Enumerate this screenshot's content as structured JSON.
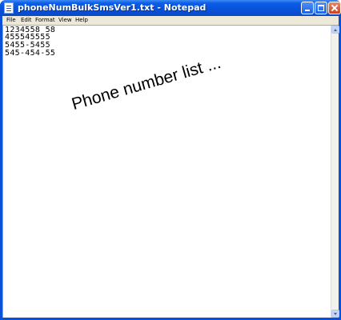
{
  "window": {
    "title": "phoneNumBulkSmsVer1.txt - Notepad",
    "title_bar_color": "#0a50d8",
    "close_button_color": "#c9421e"
  },
  "menu": {
    "items": [
      {
        "label": "File"
      },
      {
        "label": "Edit"
      },
      {
        "label": "Format"
      },
      {
        "label": "View"
      },
      {
        "label": "Help"
      }
    ]
  },
  "editor": {
    "lines": [
      "1234558 58",
      "455545555",
      "5455-5455",
      "545-454-55"
    ],
    "annotation": "Phone number list ..."
  },
  "icons": {
    "app": "notepad-icon",
    "minimize": "minimize-icon",
    "maximize": "maximize-icon",
    "close": "close-icon",
    "scroll_up": "arrow-up-icon",
    "scroll_down": "arrow-down-icon"
  }
}
